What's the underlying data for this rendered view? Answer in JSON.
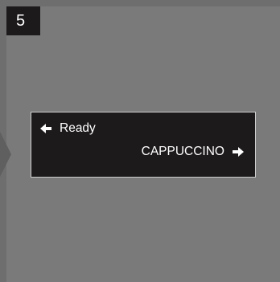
{
  "step": {
    "number": "5"
  },
  "display": {
    "status_text": "Ready",
    "status_arrow_icon": "left-arrow-icon",
    "menu_item_text": "CAPPUCCINO",
    "menu_item_arrow_icon": "right-arrow-icon"
  },
  "colors": {
    "background": "#6e6e6e",
    "panel": "#7a7a7a",
    "lcd_background": "#1d1a1b",
    "lcd_border": "#cfcfcf",
    "text": "#ffffff"
  }
}
